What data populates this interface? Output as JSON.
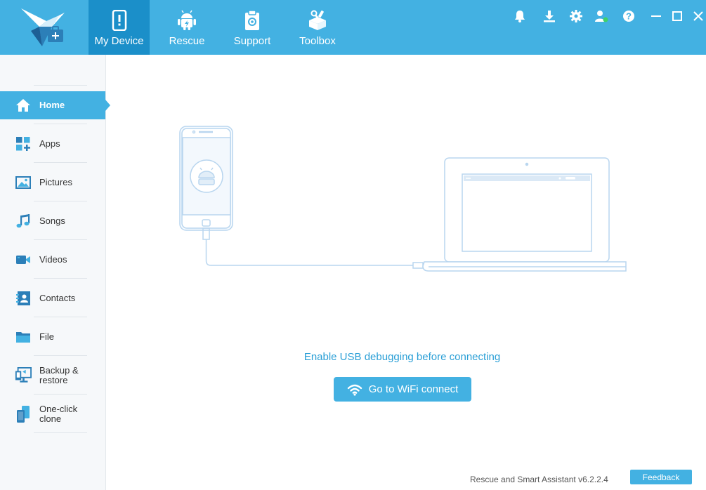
{
  "header": {
    "tabs": [
      {
        "label": "My Device",
        "icon": "phone-alert-icon",
        "active": true
      },
      {
        "label": "Rescue",
        "icon": "android-icon",
        "active": false
      },
      {
        "label": "Support",
        "icon": "clipboard-icon",
        "active": false
      },
      {
        "label": "Toolbox",
        "icon": "toolbox-icon",
        "active": false
      }
    ],
    "toolbar_icons": [
      "bell-icon",
      "download-icon",
      "gear-icon",
      "user-icon",
      "help-icon",
      "minimize-icon",
      "maximize-icon",
      "close-icon"
    ]
  },
  "sidebar": {
    "items": [
      {
        "label": "Home",
        "icon": "home-icon",
        "active": true
      },
      {
        "label": "Apps",
        "icon": "apps-icon"
      },
      {
        "label": "Pictures",
        "icon": "pictures-icon"
      },
      {
        "label": "Songs",
        "icon": "music-icon"
      },
      {
        "label": "Videos",
        "icon": "video-icon"
      },
      {
        "label": "Contacts",
        "icon": "contacts-icon"
      },
      {
        "label": "File",
        "icon": "folder-icon"
      },
      {
        "label": "Backup & restore",
        "line1": "Backup &",
        "line2": "restore",
        "icon": "backup-icon"
      },
      {
        "label": "One-click clone",
        "line1": "One-click",
        "line2": "clone",
        "icon": "clone-icon"
      }
    ]
  },
  "main": {
    "hint": "Enable USB debugging before connecting",
    "wifi_button": "Go to WiFi connect"
  },
  "footer": {
    "version": "Rescue and Smart Assistant v6.2.2.4",
    "feedback": "Feedback"
  },
  "colors": {
    "accent": "#43b1e2",
    "active_tab": "#1b8fc9",
    "hint_text": "#2a9fd6",
    "illustration_line": "#b9d6ef",
    "online_dot": "#3fd16b"
  }
}
